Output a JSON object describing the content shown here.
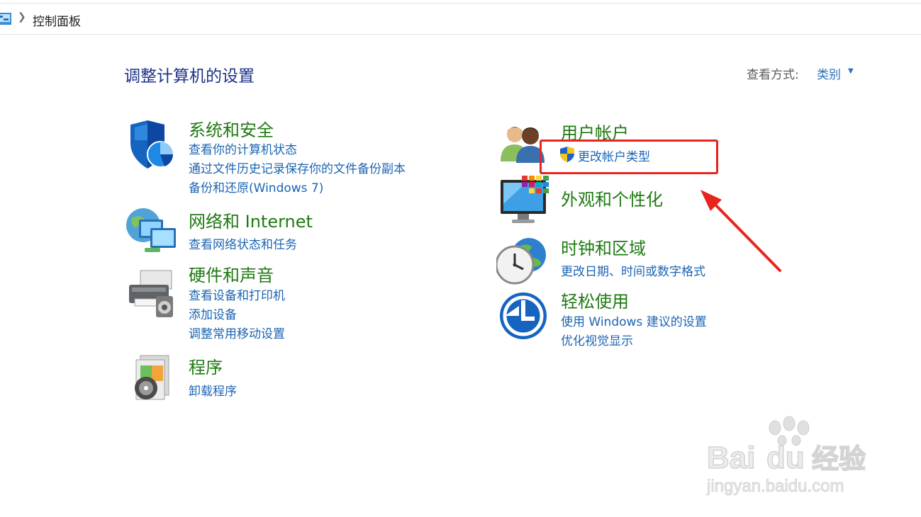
{
  "address_bar": {
    "location": "控制面板"
  },
  "header": {
    "title": "调整计算机的设置",
    "view_by_label": "查看方式:",
    "view_by_value": "类别"
  },
  "categories": {
    "system_security": {
      "title": "系统和安全",
      "links": [
        "查看你的计算机状态",
        "通过文件历史记录保存你的文件备份副本",
        "备份和还原(Windows 7)"
      ]
    },
    "network": {
      "title": "网络和 Internet",
      "links": [
        "查看网络状态和任务"
      ]
    },
    "hardware": {
      "title": "硬件和声音",
      "links": [
        "查看设备和打印机",
        "添加设备",
        "调整常用移动设置"
      ]
    },
    "programs": {
      "title": "程序",
      "links": [
        "卸载程序"
      ]
    },
    "user_accounts": {
      "title": "用户帐户",
      "links": [
        "更改帐户类型"
      ]
    },
    "appearance": {
      "title": "外观和个性化",
      "links": []
    },
    "clock_region": {
      "title": "时钟和区域",
      "links": [
        "更改日期、时间或数字格式"
      ]
    },
    "ease_of_access": {
      "title": "轻松使用",
      "links": [
        "使用 Windows 建议的设置",
        "优化视觉显示"
      ]
    }
  },
  "watermark": {
    "brand_left": "Bai",
    "brand_right": "经验",
    "url": "jingyan.baidu.com"
  },
  "colors": {
    "category_title": "#1f7a12",
    "link": "#1b64b3",
    "page_title": "#1e3287",
    "annotation": "#e8241e"
  }
}
